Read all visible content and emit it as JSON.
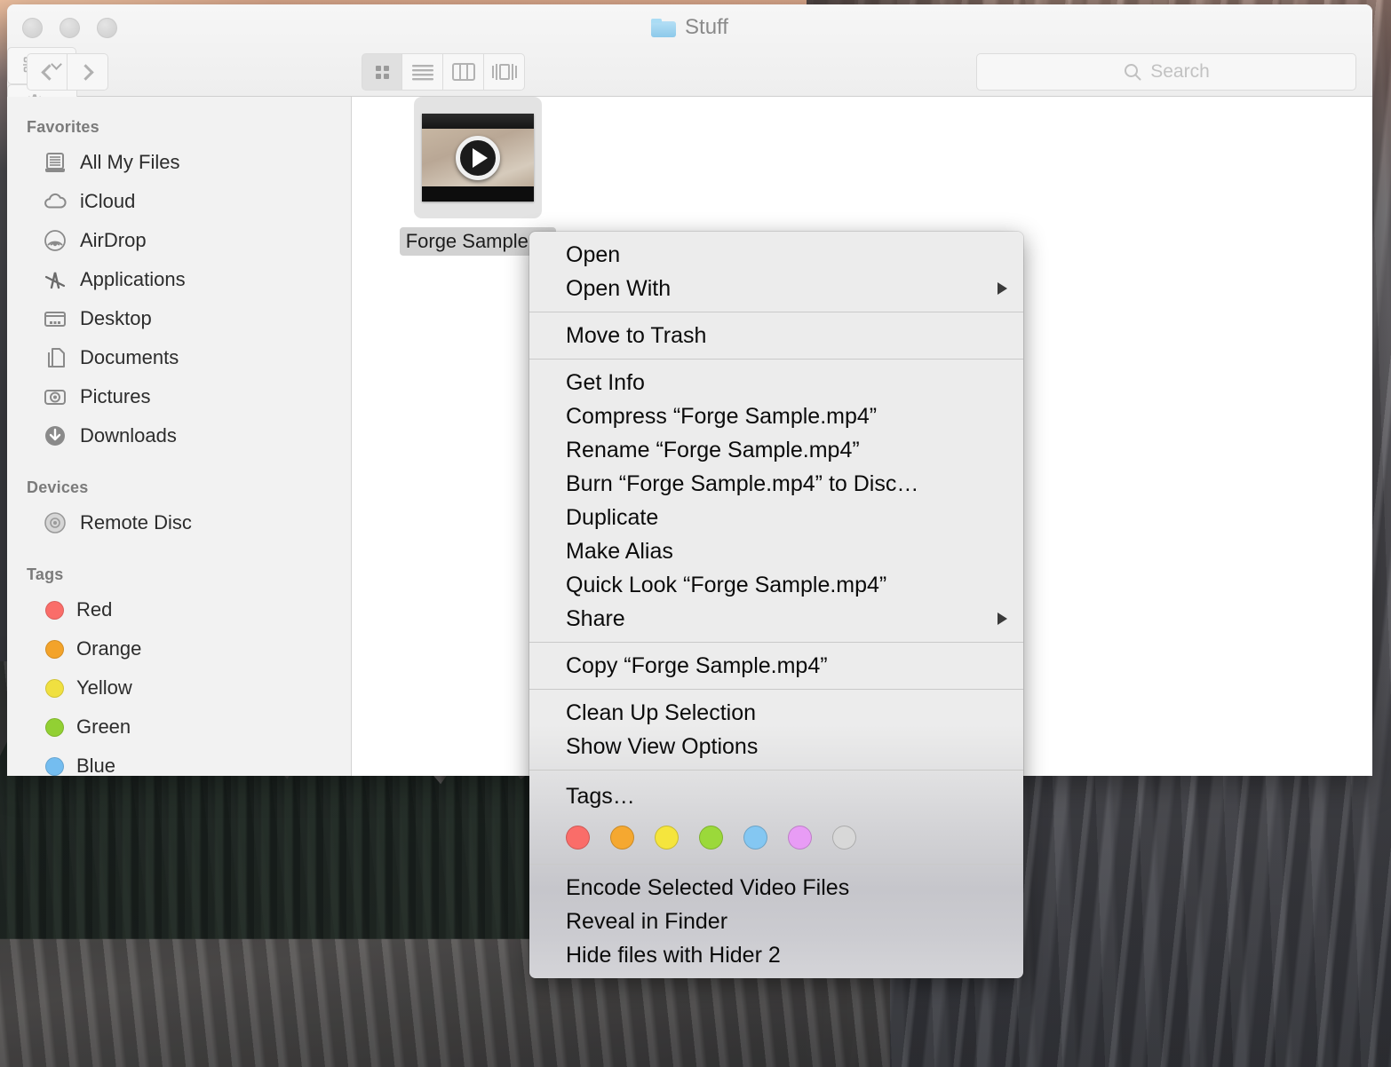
{
  "window": {
    "title": "Stuff",
    "title_icon": "folder-icon",
    "traffic_lights": [
      "close-button",
      "minimize-button",
      "zoom-button"
    ]
  },
  "toolbar": {
    "back_icon": "chevron-left-icon",
    "forward_icon": "chevron-right-icon",
    "view_buttons": [
      {
        "name": "icon-view",
        "icon": "grid-icon",
        "active": true
      },
      {
        "name": "list-view",
        "icon": "list-icon",
        "active": false
      },
      {
        "name": "column-view",
        "icon": "columns-icon",
        "active": false
      },
      {
        "name": "coverflow-view",
        "icon": "coverflow-icon",
        "active": false
      }
    ],
    "arrange_icon": "arrange-grid-icon",
    "action_icon": "gear-icon",
    "share_icon": "share-icon",
    "tag_icon": "tag-icon",
    "dropdown_icon": "chevron-down-icon"
  },
  "search": {
    "icon": "search-icon",
    "placeholder": "Search",
    "value": ""
  },
  "sidebar": {
    "sections": [
      {
        "header": "Favorites",
        "items": [
          {
            "label": "All My Files",
            "icon": "all-my-files-icon"
          },
          {
            "label": "iCloud",
            "icon": "cloud-icon"
          },
          {
            "label": "AirDrop",
            "icon": "airdrop-icon"
          },
          {
            "label": "Applications",
            "icon": "applications-icon"
          },
          {
            "label": "Desktop",
            "icon": "desktop-icon"
          },
          {
            "label": "Documents",
            "icon": "documents-icon"
          },
          {
            "label": "Pictures",
            "icon": "pictures-icon"
          },
          {
            "label": "Downloads",
            "icon": "downloads-icon"
          }
        ]
      },
      {
        "header": "Devices",
        "items": [
          {
            "label": "Remote Disc",
            "icon": "disc-icon"
          }
        ]
      },
      {
        "header": "Tags",
        "items": [
          {
            "label": "Red",
            "icon": "tag-dot",
            "color": "#fa6d69"
          },
          {
            "label": "Orange",
            "icon": "tag-dot",
            "color": "#f3a32a"
          },
          {
            "label": "Yellow",
            "icon": "tag-dot",
            "color": "#f0e040"
          },
          {
            "label": "Green",
            "icon": "tag-dot",
            "color": "#92d033"
          },
          {
            "label": "Blue",
            "icon": "tag-dot",
            "color": "#74bdf0"
          }
        ]
      }
    ]
  },
  "content": {
    "file": {
      "name": "Forge Sample.mp4",
      "label_visible": "Forge Sample.m",
      "icon": "video-file-icon",
      "selected": true
    }
  },
  "context_menu": {
    "groups": [
      {
        "items": [
          {
            "label": "Open",
            "submenu": false
          },
          {
            "label": "Open With",
            "submenu": true
          }
        ]
      },
      {
        "items": [
          {
            "label": "Move to Trash",
            "submenu": false
          }
        ]
      },
      {
        "items": [
          {
            "label": "Get Info",
            "submenu": false
          },
          {
            "label": "Compress “Forge Sample.mp4”",
            "submenu": false
          },
          {
            "label": "Rename “Forge Sample.mp4”",
            "submenu": false
          },
          {
            "label": "Burn “Forge Sample.mp4” to Disc…",
            "submenu": false
          },
          {
            "label": "Duplicate",
            "submenu": false
          },
          {
            "label": "Make Alias",
            "submenu": false
          },
          {
            "label": "Quick Look “Forge Sample.mp4”",
            "submenu": false
          },
          {
            "label": "Share",
            "submenu": true
          }
        ]
      },
      {
        "items": [
          {
            "label": "Copy “Forge Sample.mp4”",
            "submenu": false
          }
        ]
      },
      {
        "items": [
          {
            "label": "Clean Up Selection",
            "submenu": false
          },
          {
            "label": "Show View Options",
            "submenu": false
          }
        ]
      },
      {
        "items": [
          {
            "label": "Encode Selected Video Files",
            "submenu": false
          },
          {
            "label": "Reveal in Finder",
            "submenu": false
          },
          {
            "label": "Hide files with Hider 2",
            "submenu": false
          }
        ]
      }
    ],
    "tags": {
      "label": "Tags…",
      "swatches": [
        {
          "name": "red-tag-swatch",
          "color": "#fa6d69"
        },
        {
          "name": "orange-tag-swatch",
          "color": "#f5a830"
        },
        {
          "name": "yellow-tag-swatch",
          "color": "#f5e53d"
        },
        {
          "name": "green-tag-swatch",
          "color": "#9bd93a"
        },
        {
          "name": "blue-tag-swatch",
          "color": "#84c7f2"
        },
        {
          "name": "purple-tag-swatch",
          "color": "#e89cf5"
        },
        {
          "name": "gray-tag-swatch",
          "color": "#d8d8d8"
        }
      ]
    }
  }
}
